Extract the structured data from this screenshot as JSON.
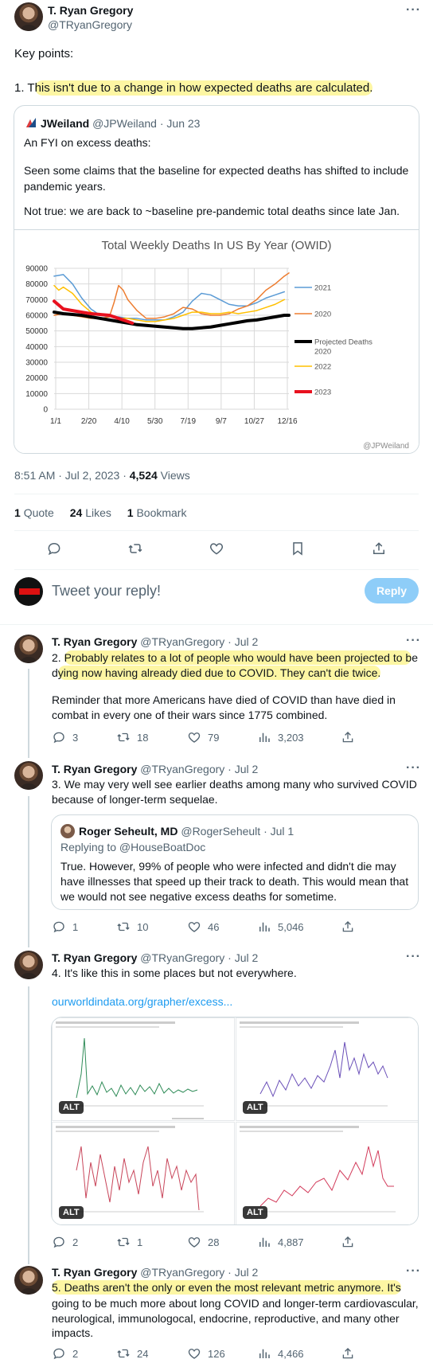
{
  "main": {
    "author_name": "T. Ryan Gregory",
    "handle": "@TRyanGregory",
    "key_points": "Key points:",
    "point1_prefix": "1. T",
    "point1_hl": "his isn't due to a change in how expected deaths are calculated.",
    "quote": {
      "name": "JWeiland",
      "handle": "@JPWeiland",
      "date": "· Jun 23",
      "line1": "An FYI on excess deaths:",
      "line2": "Seen some claims that the baseline for expected deaths has shifted to include pandemic years.",
      "line3": "Not true: we are back to ~baseline pre-pandemic total deaths since late Jan."
    },
    "timestamp": "8:51 AM · Jul 2, 2023 · ",
    "views_count": "4,524",
    "views_label": " Views",
    "stats": {
      "quote_count": "1",
      "quote_label": "Quote",
      "likes_count": "24",
      "likes_label": "Likes",
      "bookmark_count": "1",
      "bookmark_label": "Bookmark"
    }
  },
  "reply_box": {
    "placeholder": "Tweet your reply!",
    "button": "Reply"
  },
  "chart_data": {
    "type": "line",
    "title": "Total Weekly Deaths In US By Year (OWID)",
    "x_tick_labels": [
      "1/1",
      "2/20",
      "4/10",
      "5/30",
      "7/19",
      "9/7",
      "10/27",
      "12/16"
    ],
    "y_tick_labels": [
      "0",
      "10000",
      "20000",
      "30000",
      "40000",
      "50000",
      "60000",
      "70000",
      "80000",
      "90000"
    ],
    "ylim": [
      0,
      90000
    ],
    "xlim": [
      0,
      51
    ],
    "grid": true,
    "legend_position": "right",
    "watermark": "@JPWeiland",
    "series": [
      {
        "name": "2021",
        "color": "#5b9bd5",
        "width": 1.5,
        "x": [
          0,
          2,
          4,
          6,
          8,
          10,
          12,
          14,
          16,
          18,
          20,
          22,
          24,
          26,
          28,
          30,
          32,
          34,
          36,
          38,
          40,
          42,
          44,
          46,
          48,
          50
        ],
        "values": [
          85000,
          86000,
          80000,
          71000,
          64000,
          60000,
          59000,
          59000,
          58000,
          58000,
          57000,
          57000,
          57000,
          59000,
          62000,
          69000,
          74000,
          73000,
          70000,
          67000,
          66000,
          66000,
          68000,
          71000,
          73000,
          75000
        ]
      },
      {
        "name": "2020",
        "color": "#ed7d31",
        "width": 1.5,
        "x": [
          0,
          2,
          4,
          6,
          8,
          10,
          12,
          13,
          14,
          15,
          16,
          18,
          20,
          22,
          24,
          26,
          28,
          30,
          32,
          34,
          36,
          38,
          40,
          42,
          44,
          46,
          48,
          50,
          51
        ],
        "values": [
          60000,
          61000,
          60000,
          59000,
          58000,
          58000,
          59000,
          68000,
          79000,
          76000,
          70000,
          63000,
          58000,
          58000,
          59000,
          61000,
          65000,
          64000,
          61000,
          60000,
          60000,
          61000,
          64000,
          66000,
          70000,
          76000,
          80000,
          85000,
          87000
        ]
      },
      {
        "name": "Projected Deaths 2020",
        "color": "#000000",
        "width": 4,
        "x": [
          0,
          2,
          4,
          6,
          8,
          10,
          12,
          14,
          16,
          18,
          20,
          22,
          24,
          26,
          28,
          30,
          32,
          34,
          36,
          38,
          40,
          42,
          44,
          46,
          48,
          50,
          51
        ],
        "values": [
          62000,
          61000,
          60500,
          60000,
          59000,
          58000,
          57000,
          56000,
          55000,
          54000,
          53500,
          53000,
          52500,
          52000,
          51500,
          51500,
          52000,
          52500,
          53500,
          54500,
          55500,
          56500,
          57000,
          58000,
          59000,
          60000,
          60000
        ]
      },
      {
        "name": "2022",
        "color": "#ffc000",
        "width": 1.5,
        "x": [
          0,
          1,
          2,
          4,
          6,
          8,
          10,
          12,
          14,
          16,
          18,
          20,
          22,
          24,
          26,
          28,
          30,
          32,
          34,
          36,
          38,
          40,
          42,
          44,
          46,
          48,
          50
        ],
        "values": [
          79000,
          76000,
          78000,
          74000,
          67000,
          62000,
          60000,
          60000,
          58000,
          58000,
          57000,
          56000,
          56000,
          57000,
          58000,
          60000,
          62000,
          62000,
          61000,
          61000,
          62000,
          61000,
          62000,
          63000,
          65000,
          67000,
          70000
        ]
      },
      {
        "name": "2023",
        "color": "#e8101e",
        "width": 4,
        "x": [
          0,
          2,
          4,
          6,
          8,
          10,
          12,
          14,
          16,
          17
        ],
        "values": [
          69000,
          64000,
          63000,
          62000,
          61000,
          60500,
          60000,
          58000,
          56000,
          55000
        ]
      }
    ]
  },
  "replies": [
    {
      "author": "T. Ryan Gregory",
      "handle": "@TRyanGregory · Jul 2",
      "l1a": "2. ",
      "l1hl": "Probably relates to a lot of people who would have been projected to b",
      "l1b": "e",
      "l2a": "d",
      "l2hl": "ying now having already died due to COVID. They can't die twice.",
      "p2": "Reminder that more Americans have died of COVID than have died in combat in every one of their wars since 1775 combined.",
      "comments": "3",
      "retweets": "18",
      "likes": "79",
      "views": "3,203"
    },
    {
      "author": "T. Ryan Gregory",
      "handle": "@TRyanGregory · Jul 2",
      "text": "3. We may very well see earlier deaths among many who survived COVID because of longer-term sequelae.",
      "quote_name": "Roger Seheult, MD",
      "quote_handle": "@RogerSeheult · Jul 1",
      "quote_reply": "Replying to @HouseBoatDoc",
      "quote_text": "True. However, 99% of people who were infected and didn't die may have illnesses that speed up their track to death. This would mean that we would not see negative excess deaths for sometime.",
      "comments": "1",
      "retweets": "10",
      "likes": "46",
      "views": "5,046"
    },
    {
      "author": "T. Ryan Gregory",
      "handle": "@TRyanGregory · Jul 2",
      "text": "4. It's like this in some places but not everywhere.",
      "link": "ourworldindata.org/grapher/excess...",
      "alt": "ALT",
      "comments": "2",
      "retweets": "1",
      "likes": "28",
      "views": "4,887"
    },
    {
      "author": "T. Ryan Gregory",
      "handle": "@TRyanGregory · Jul 2",
      "hl": "5. Deaths aren't the only or even the most relevant metric anymore. It's",
      "rest": "going to be much more about long COVID and longer-term cardiovascular, neurological, immunologocal, endocrine, reproductive, and many other impacts.",
      "comments": "2",
      "retweets": "24",
      "likes": "126",
      "views": "4,466"
    }
  ],
  "colors": {
    "text": "#0f1419",
    "muted": "#536471",
    "link": "#1d9bf0",
    "highlight": "#fdf6a3",
    "reply_button": "#8ecdf8"
  }
}
